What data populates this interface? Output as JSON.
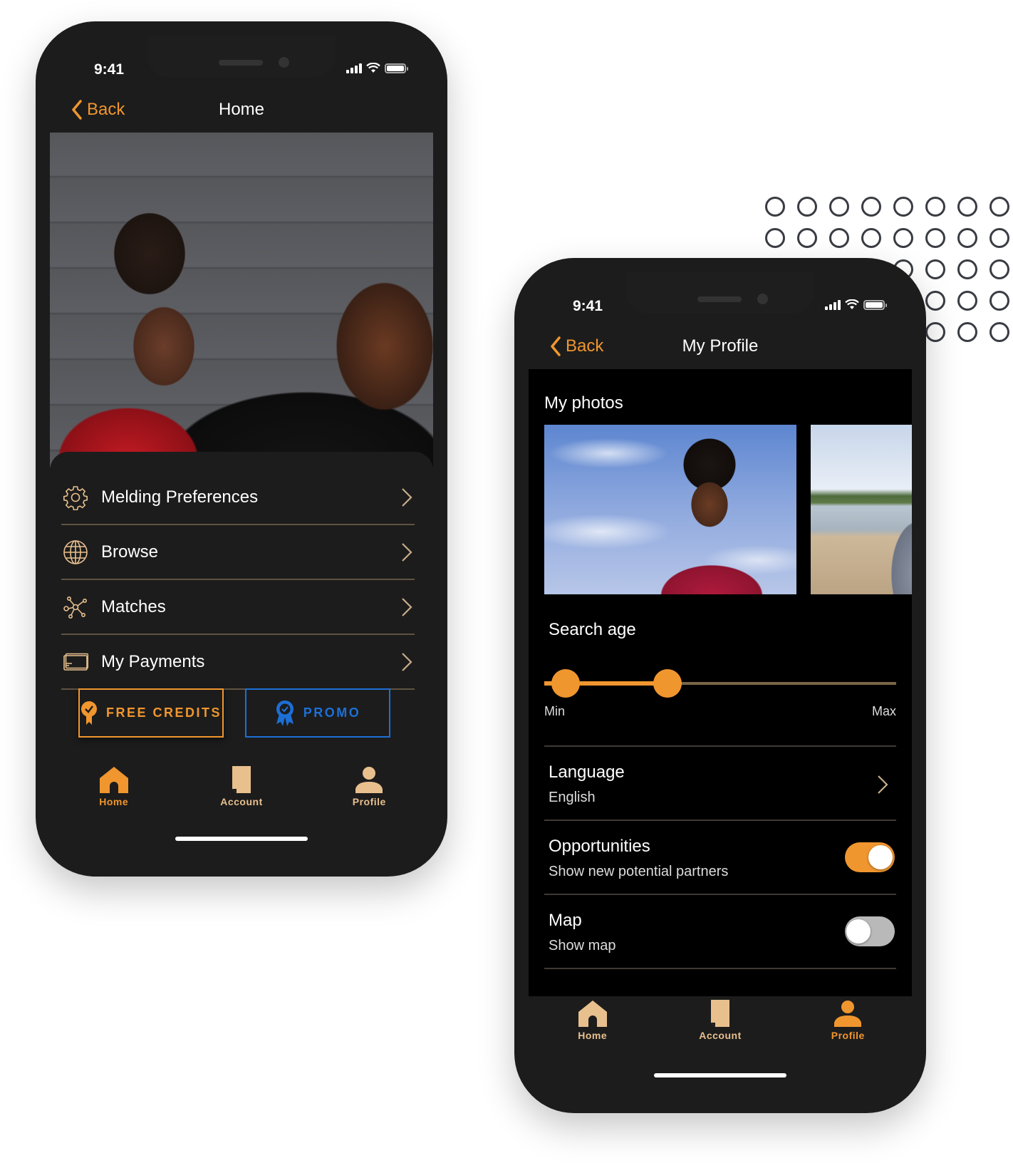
{
  "colors": {
    "accent": "#f0962f",
    "accent_light": "#e8c08e",
    "promo_blue": "#1d6fd6",
    "divider": "#5e5342",
    "screen_bg": "#1c1c1c"
  },
  "phone_home": {
    "status": {
      "time": "9:41",
      "icons": [
        "signal-icon",
        "wifi-icon",
        "battery-icon"
      ]
    },
    "nav": {
      "back_label": "Back",
      "title": "Home"
    },
    "hero_image": "couple-photo",
    "menu": [
      {
        "label": "Melding Preferences",
        "icon": "gear-icon"
      },
      {
        "label": "Browse",
        "icon": "globe-icon"
      },
      {
        "label": "Matches",
        "icon": "network-icon"
      },
      {
        "label": "My Payments",
        "icon": "credit-card-icon"
      }
    ],
    "buttons": {
      "free_credits": {
        "label": "FREE CREDITS",
        "icon": "badge-icon"
      },
      "promo": {
        "label": "PROMO",
        "icon": "award-ribbon-icon"
      }
    },
    "tabs": [
      {
        "label": "Home",
        "icon": "home-icon",
        "active": true
      },
      {
        "label": "Account",
        "icon": "document-icon",
        "active": false
      },
      {
        "label": "Profile",
        "icon": "person-icon",
        "active": false
      }
    ]
  },
  "phone_profile": {
    "status": {
      "time": "9:41",
      "icons": [
        "signal-icon",
        "wifi-icon",
        "battery-icon"
      ]
    },
    "nav": {
      "back_label": "Back",
      "title": "My Profile"
    },
    "photos": {
      "title": "My photos",
      "items": [
        "woman-sky-photo",
        "beach-photo"
      ]
    },
    "search_age": {
      "title": "Search age",
      "min_label": "Min",
      "max_label": "Max",
      "range_low_fraction": 0.06,
      "range_high_fraction": 0.35
    },
    "settings": [
      {
        "title": "Language",
        "subtitle": "English",
        "type": "link"
      },
      {
        "title": "Opportunities",
        "subtitle": "Show new potential partners",
        "type": "toggle",
        "on": true
      },
      {
        "title": "Map",
        "subtitle": "Show map",
        "type": "toggle",
        "on": false
      }
    ],
    "tabs": [
      {
        "label": "Home",
        "icon": "home-icon",
        "active": false
      },
      {
        "label": "Account",
        "icon": "document-icon",
        "active": false
      },
      {
        "label": "Profile",
        "icon": "person-icon",
        "active": true
      }
    ]
  }
}
